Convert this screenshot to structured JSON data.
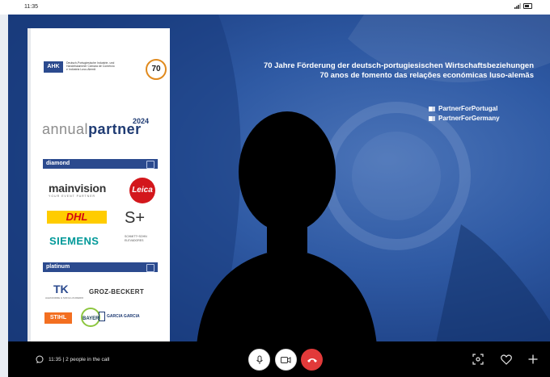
{
  "status_bar": {
    "time": "11:35",
    "signal_icon": "signal-icon",
    "battery_icon": "battery-icon"
  },
  "banner": {
    "headline_de": "70 Jahre Förderung der deutsch-portugiesischen Wirtschaftsbeziehungen",
    "headline_pt": "70 anos de fomento das relações económicas luso-alemãs",
    "hashtags": [
      "PartnerForPortugal",
      "PartnerForGermany"
    ]
  },
  "partner_panel": {
    "org_abbrev": "AHK",
    "org_name": "Deutsch-Portugiesische Industrie- und Handelskammer Câmara de Comércio e Indústria Luso-Alemã",
    "anniversary": "70",
    "annual_word": "annual",
    "partner_word": "partner",
    "year": "2024",
    "tiers": [
      {
        "name": "diamond",
        "sponsors": [
          "mainvision",
          "YOUR EVENT PARTNER",
          "Leica",
          "DHL",
          "S+",
          "SIEMENS",
          "SCHMITT+SOHN ELEVADORES"
        ]
      },
      {
        "name": "platinum",
        "sponsors": [
          "TK",
          "ALEXANDRE & SOFIA LOUREIRO",
          "GROZ-BECKERT",
          "STIHL",
          "BAYER",
          "GARCIA GARCIA"
        ]
      }
    ]
  },
  "call_bar": {
    "status_text": "11:35 | 2 people in the call",
    "chat_icon": "chat-icon",
    "controls": [
      "microphone-icon",
      "camera-icon",
      "hang-up-icon"
    ],
    "right_controls": [
      "screen-focus-icon",
      "heart-icon",
      "add-icon"
    ]
  },
  "colors": {
    "hang_up": "#e23a3a",
    "call_bar_bg": "#000000",
    "banner_blue": "#2f5aa4",
    "tier_bar": "#2b4a8e",
    "siemens_teal": "#009999"
  }
}
